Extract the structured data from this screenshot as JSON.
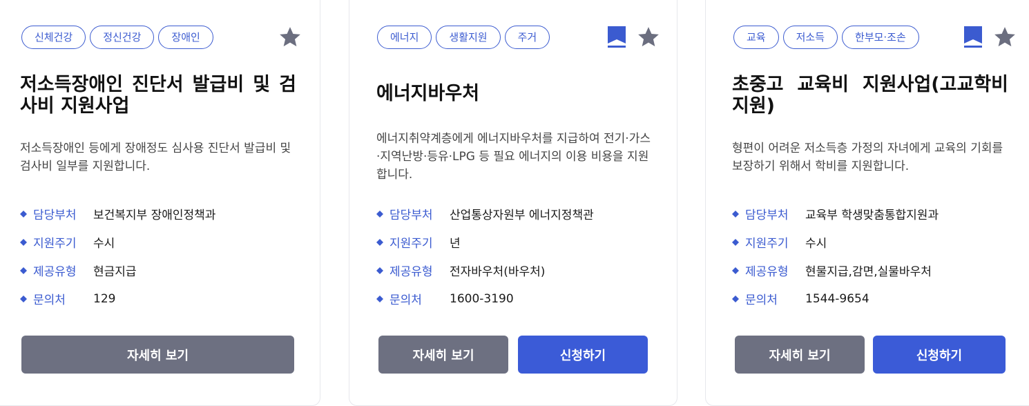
{
  "cards": [
    {
      "tags": [
        "신체건강",
        "정신건강",
        "장애인"
      ],
      "title": "저소득장애인 진단서 발급비 및 검사비 지원사업",
      "description": "저소득장애인 등에게 장애정도 심사용 진단서 발급비 및 검사비 일부를 지원합니다.",
      "info": [
        {
          "label": "담당부처",
          "value": "보건복지부 장애인정책과"
        },
        {
          "label": "지원주기",
          "value": "수시"
        },
        {
          "label": "제공유형",
          "value": "현금지급"
        },
        {
          "label": "문의처",
          "value": "129"
        }
      ],
      "detail_label": "자세히 보기"
    },
    {
      "tags": [
        "에너지",
        "생활지원",
        "주거"
      ],
      "title": "에너지바우처",
      "description": "에너지취약계층에게 에너지바우처를 지급하여 전기·가스·지역난방·등유·LPG 등 필요 에너지의 이용 비용을 지원합니다.",
      "info": [
        {
          "label": "담당부처",
          "value": "산업통상자원부 에너지정책관"
        },
        {
          "label": "지원주기",
          "value": "년"
        },
        {
          "label": "제공유형",
          "value": "전자바우처(바우처)"
        },
        {
          "label": "문의처",
          "value": "1600-3190"
        }
      ],
      "detail_label": "자세히 보기",
      "apply_label": "신청하기"
    },
    {
      "tags": [
        "교육",
        "저소득",
        "한부모·조손"
      ],
      "title": "초중고 교육비 지원사업(고교학비 지원)",
      "description": "형편이 어려운 저소득층 가정의 자녀에게 교육의 기회를 보장하기 위해서 학비를 지원합니다.",
      "info": [
        {
          "label": "담당부처",
          "value": "교육부 학생맞춤통합지원과"
        },
        {
          "label": "지원주기",
          "value": "수시"
        },
        {
          "label": "제공유형",
          "value": "현물지급,감면,실물바우처"
        },
        {
          "label": "문의처",
          "value": "1544-9654"
        }
      ],
      "detail_label": "자세히 보기",
      "apply_label": "신청하기"
    }
  ],
  "colors": {
    "accent": "#3b5bd0",
    "star": "#6b6e7f",
    "detail_button": "#6d7081",
    "apply_button": "#3b5bd7"
  }
}
